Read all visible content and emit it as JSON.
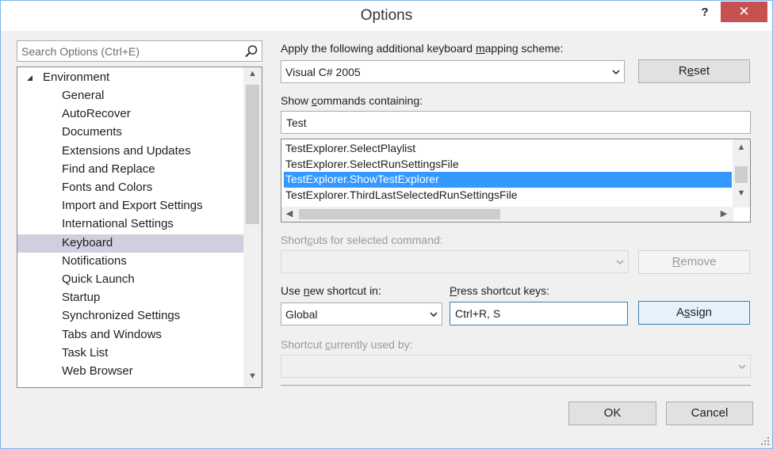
{
  "window": {
    "title": "Options",
    "help_label": "?",
    "close_label": "✕"
  },
  "search": {
    "placeholder": "Search Options (Ctrl+E)"
  },
  "tree": {
    "root_label": "Environment",
    "items": [
      "General",
      "AutoRecover",
      "Documents",
      "Extensions and Updates",
      "Find and Replace",
      "Fonts and Colors",
      "Import and Export Settings",
      "International Settings",
      "Keyboard",
      "Notifications",
      "Quick Launch",
      "Startup",
      "Synchronized Settings",
      "Tabs and Windows",
      "Task List",
      "Web Browser"
    ],
    "selected": "Keyboard"
  },
  "keyboard": {
    "mapping_label_pre": "Apply the following additional keyboard ",
    "mapping_label_u": "m",
    "mapping_label_post": "apping scheme:",
    "mapping_value": "Visual C# 2005",
    "reset_pre": "R",
    "reset_u": "e",
    "reset_post": "set",
    "show_label_pre": "Show ",
    "show_label_u": "c",
    "show_label_post": "ommands containing:",
    "filter_value": "Test",
    "commands": [
      "TestExplorer.SelectPlaylist",
      "TestExplorer.SelectRunSettingsFile",
      "TestExplorer.ShowTestExplorer",
      "TestExplorer.ThirdLastSelectedRunSettingsFile"
    ],
    "selected_command": "TestExplorer.ShowTestExplorer",
    "shortcuts_label_pre": "Short",
    "shortcuts_label_u": "c",
    "shortcuts_label_post": "uts for selected command:",
    "remove_pre": "",
    "remove_u": "R",
    "remove_post": "emove",
    "use_label_pre": "Use ",
    "use_label_u": "n",
    "use_label_post": "ew shortcut in:",
    "use_value": "Global",
    "press_label_pre": "",
    "press_label_u": "P",
    "press_label_post": "ress shortcut keys:",
    "press_value": "Ctrl+R, S",
    "assign_pre": "A",
    "assign_u": "s",
    "assign_post": "sign",
    "used_label_pre": "Shortcut ",
    "used_label_u": "c",
    "used_label_post": "urrently used by:"
  },
  "footer": {
    "ok_label": "OK",
    "cancel_label": "Cancel"
  }
}
